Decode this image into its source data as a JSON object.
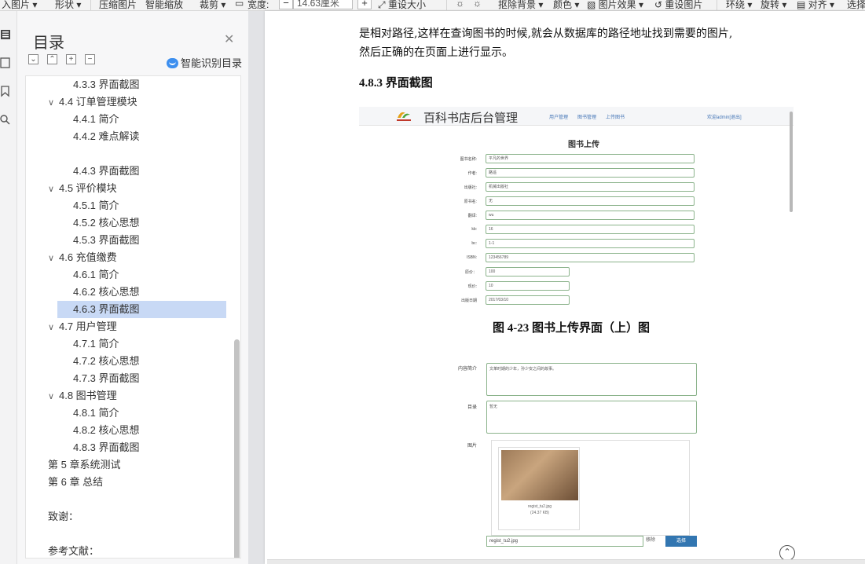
{
  "ribbon": {
    "insert_image": "入图片",
    "shape": "形状",
    "compress": "压缩图片",
    "smart_zoom": "智能缩放",
    "crop": "裁剪",
    "width_label": "宽度:",
    "width_value": "14.63厘米",
    "reset_size": "重设大小",
    "remove_bg": "抠除背景",
    "color": "颜色",
    "img_effect": "图片效果",
    "reset_img": "重设图片",
    "wrap": "环绕",
    "rotate": "旋转",
    "align": "对齐",
    "select": "选择"
  },
  "toc": {
    "title": "目录",
    "smart_label": "智能识别目录",
    "items": [
      {
        "label": "4.3.3 界面截图",
        "level": 3
      },
      {
        "label": "4.4 订单管理模块",
        "level": 2
      },
      {
        "label": "4.4.1 简介",
        "level": 3
      },
      {
        "label": "4.4.2 难点解读",
        "level": 3
      },
      {
        "label": "4.4.3 界面截图",
        "level": 3
      },
      {
        "label": "4.5 评价模块",
        "level": 2
      },
      {
        "label": "4.5.1 简介",
        "level": 3
      },
      {
        "label": "4.5.2 核心思想",
        "level": 3
      },
      {
        "label": "4.5.3 界面截图",
        "level": 3
      },
      {
        "label": "4.6 充值缴费",
        "level": 2
      },
      {
        "label": "4.6.1 简介",
        "level": 3
      },
      {
        "label": "4.6.2 核心思想",
        "level": 3
      },
      {
        "label": "4.6.3 界面截图",
        "level": 3,
        "selected": true
      },
      {
        "label": "4.7 用户管理",
        "level": 2
      },
      {
        "label": "4.7.1 简介",
        "level": 3
      },
      {
        "label": "4.7.2 核心思想",
        "level": 3
      },
      {
        "label": "4.7.3 界面截图",
        "level": 3
      },
      {
        "label": "4.8 图书管理",
        "level": 2
      },
      {
        "label": "4.8.1 简介",
        "level": 3
      },
      {
        "label": "4.8.2  核心思想",
        "level": 3
      },
      {
        "label": "4.8.3 界面截图",
        "level": 3
      },
      {
        "label": "第 5 章系统测试",
        "level": 1
      },
      {
        "label": "第 6 章  总结",
        "level": 1
      },
      {
        "label": "致谢：",
        "level": 1
      },
      {
        "label": "参考文献：",
        "level": 1
      }
    ]
  },
  "doc": {
    "para_line1": "是相对路径,这样在查询图书的时候,就会从数据库的路径地址找到需要的图片,",
    "para_line2": "然后正确的在页面上进行显示。",
    "heading": "4.8.3 界面截图",
    "caption": "图 4-23 图书上传界面（上）图"
  },
  "shot1": {
    "brand": "百科书店后台管理",
    "nav_users": "用户管理",
    "nav_books": "图书管理",
    "nav_upload": "上传图书",
    "welcome": "欢迎admin[退出]",
    "form_title": "图书上传",
    "fields": [
      {
        "label": "图书名称:",
        "value": "平凡的世界"
      },
      {
        "label": "作者:",
        "value": "路遥"
      },
      {
        "label": "出版社:",
        "value": "机械出版社"
      },
      {
        "label": "原书名:",
        "value": "无"
      },
      {
        "label": "翻译:",
        "value": "wu"
      },
      {
        "label": "kb:",
        "value": "16"
      },
      {
        "label": "bc:",
        "value": "1-1"
      },
      {
        "label": "ISBN:",
        "value": "123456789"
      },
      {
        "label": "原价：",
        "value": "100"
      },
      {
        "label": "现价:",
        "value": "10"
      },
      {
        "label": "出版日期",
        "value": "2017/03/10"
      }
    ]
  },
  "shot2": {
    "intro_label": "内容简介",
    "intro_value": "文革时期的少年，孙少安之间的故事。",
    "toc_label": "目录",
    "toc_value": "暂无",
    "image_label": "图片",
    "file_name": "regist_tu2.jpg",
    "file_size": "(24.37 KB)",
    "file_input": "regist_tu2.jpg",
    "remove": "移除",
    "choose": "选择"
  }
}
